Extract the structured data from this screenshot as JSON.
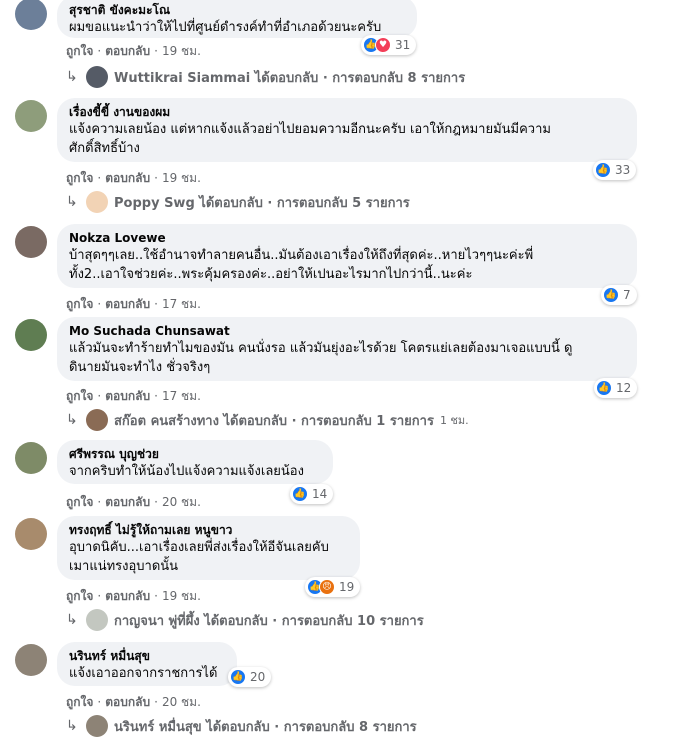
{
  "comments": [
    {
      "author": "สุรชาติ ขังคะมะโณ",
      "lines": [
        "ผมขอแนะนำว่าให้ไปที่ศูนย์ดำรงค์ทำที่อำเภอด้วยนะครับ"
      ],
      "reactions": "31",
      "reaction_icons": [
        "like",
        "love"
      ],
      "like": "ถูกใจ",
      "reply": "ตอบกลับ",
      "time": "19 ชม.",
      "replies_text": "Wuttikrai Siammai ได้ตอบกลับ · การตอบกลับ 8 รายการ"
    },
    {
      "author": "เรื่องขี้ขี้ งานของผม",
      "lines": [
        "แจ้งความเลยน้อง แต่หากแจ้งแล้วอย่าไปยอมความอีกนะครับ เอาให้กฎหมายมันมีความ",
        "ศักดิ์สิทธิ์บ้าง"
      ],
      "reactions": "33",
      "reaction_icons": [
        "like"
      ],
      "like": "ถูกใจ",
      "reply": "ตอบกลับ",
      "time": "19 ชม.",
      "replies_text": "Poppy Swg ได้ตอบกลับ · การตอบกลับ 5 รายการ"
    },
    {
      "author": "Nokza Lovewe",
      "lines": [
        "บ้าสุดๆๆเลย..ใช้อำนาจทำลายคนอื่น..มันต้องเอาเรื่องให้ถึงที่สุดค่ะ..หายไวๆๆนะค่ะพี่",
        "ทั้ง2..เอาใจช่วยค่ะ..พระคุ้มครองค่ะ..อย่าให้เปนอะไรมากไปกว่านี้..นะค่ะ"
      ],
      "reactions": "7",
      "reaction_icons": [
        "like"
      ],
      "like": "ถูกใจ",
      "reply": "ตอบกลับ",
      "time": "17 ชม.",
      "replies_text": ""
    },
    {
      "author": "Mo Suchada Chunsawat",
      "lines": [
        "แล้วมันจะทำร้ายทำไมของมัน คนนั่งรอ แล้วมันยุ่งอะไรด้วย โคตรแย่เลยต้องมาเจอแบบนี้ ดู",
        "ดินายมันจะทำไง ชั่วจริงๆ"
      ],
      "reactions": "12",
      "reaction_icons": [
        "like"
      ],
      "like": "ถูกใจ",
      "reply": "ตอบกลับ",
      "time": "17 ชม.",
      "replies_text": "สก๊อต คนสร้างทาง ได้ตอบกลับ · การตอบกลับ 1 รายการ",
      "replies_time": "1 ชม."
    },
    {
      "author": "ศรีพรรณ บุญช่วย",
      "lines": [
        "จากคริบทำให้น้องไปแจ้งความแจ้งเลยน้อง"
      ],
      "reactions": "14",
      "reaction_icons": [
        "like"
      ],
      "like": "ถูกใจ",
      "reply": "ตอบกลับ",
      "time": "20 ชม.",
      "replies_text": ""
    },
    {
      "author": "ทรงฤทธิ์ ไม่รู้ให้ถามเลย หนูขาว",
      "lines": [
        "อุบาดนิคับ...เอาเรื่องเลยพี่ส่งเรื่องให้อีจันเลยคับ",
        "เมาแน่ทรงอุบาดนั้น"
      ],
      "reactions": "19",
      "reaction_icons": [
        "like",
        "angry"
      ],
      "like": "ถูกใจ",
      "reply": "ตอบกลับ",
      "time": "19 ชม.",
      "replies_text": "กาญจนา พู่ที่ผึ้ง ได้ตอบกลับ · การตอบกลับ 10 รายการ"
    },
    {
      "author": "นรินทร์ หมื่นสุข",
      "lines": [
        "แจ้งเอาออกจากราชการได้"
      ],
      "reactions": "20",
      "reaction_icons": [
        "like"
      ],
      "like": "ถูกใจ",
      "reply": "ตอบกลับ",
      "time": "20 ชม.",
      "replies_text": "นรินทร์ หมื่นสุข ได้ตอบกลับ · การตอบกลับ 8 รายการ"
    }
  ],
  "colors": {
    "bubble": "#f0f2f5",
    "meta": "#65676b",
    "like_blue": "#1877f2",
    "love_red": "#f33e58",
    "angry_orange": "#e9710f"
  }
}
